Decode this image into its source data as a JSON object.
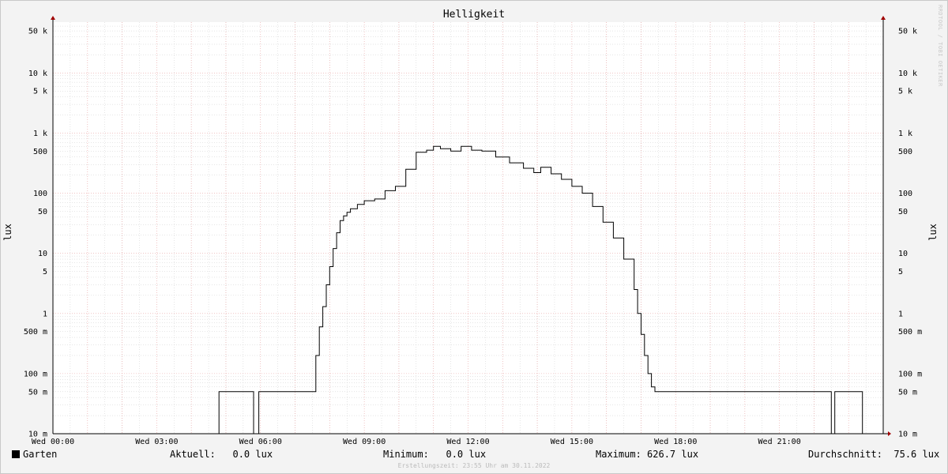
{
  "chart_data": {
    "type": "line",
    "title": "Helligkeit",
    "ylabel": "lux",
    "yscale": "log",
    "ylim": [
      0.01,
      70000
    ],
    "xlim": [
      0,
      24
    ],
    "y_ticks": [
      {
        "value": 50000,
        "label": "50 k"
      },
      {
        "value": 10000,
        "label": "10 k"
      },
      {
        "value": 5000,
        "label": "5 k"
      },
      {
        "value": 1000,
        "label": "1 k"
      },
      {
        "value": 500,
        "label": "500"
      },
      {
        "value": 100,
        "label": "100"
      },
      {
        "value": 50,
        "label": "50"
      },
      {
        "value": 10,
        "label": "10"
      },
      {
        "value": 5,
        "label": "5"
      },
      {
        "value": 1,
        "label": "1"
      },
      {
        "value": 0.5,
        "label": "500 m"
      },
      {
        "value": 0.1,
        "label": "100 m"
      },
      {
        "value": 0.05,
        "label": "50 m"
      },
      {
        "value": 0.01,
        "label": "10 m"
      }
    ],
    "x_ticks": [
      {
        "value": 0,
        "label": "Wed 00:00"
      },
      {
        "value": 3,
        "label": "Wed 03:00"
      },
      {
        "value": 6,
        "label": "Wed 06:00"
      },
      {
        "value": 9,
        "label": "Wed 09:00"
      },
      {
        "value": 12,
        "label": "Wed 12:00"
      },
      {
        "value": 15,
        "label": "Wed 15:00"
      },
      {
        "value": 18,
        "label": "Wed 18:00"
      },
      {
        "value": 21,
        "label": "Wed 21:00"
      }
    ],
    "grid": true,
    "colors": {
      "line": "#000000",
      "major_grid": "#e8a0a0",
      "minor_grid": "#cccccc",
      "axis": "#000000",
      "arrow": "#a00000"
    },
    "series": [
      {
        "name": "Garten",
        "x": [
          0,
          4.8,
          4.8,
          5.8,
          5.8,
          5.95,
          5.95,
          7.5,
          7.6,
          7.7,
          7.8,
          7.9,
          8.0,
          8.1,
          8.2,
          8.3,
          8.4,
          8.5,
          8.6,
          8.8,
          9.0,
          9.3,
          9.6,
          9.9,
          10.2,
          10.5,
          10.8,
          11.0,
          11.2,
          11.5,
          11.8,
          12.1,
          12.4,
          12.8,
          13.2,
          13.6,
          13.9,
          14.1,
          14.4,
          14.7,
          15.0,
          15.3,
          15.6,
          15.9,
          16.2,
          16.5,
          16.8,
          16.9,
          17.0,
          17.1,
          17.2,
          17.3,
          17.4,
          17.5,
          17.6,
          17.7,
          17.7,
          22.5,
          22.5,
          22.6,
          22.6,
          23.4,
          23.4,
          24
        ],
        "values": [
          0.01,
          0.01,
          0.05,
          0.05,
          0.01,
          0.01,
          0.05,
          0.05,
          0.2,
          0.6,
          1.3,
          3,
          6,
          12,
          22,
          35,
          42,
          48,
          55,
          65,
          75,
          80,
          110,
          130,
          250,
          480,
          520,
          600,
          550,
          500,
          600,
          520,
          500,
          400,
          320,
          260,
          220,
          270,
          210,
          170,
          130,
          100,
          60,
          33,
          18,
          8,
          2.5,
          1.0,
          0.45,
          0.2,
          0.1,
          0.06,
          0.05,
          0.05,
          0.05,
          0.05,
          0.05,
          0.05,
          0.01,
          0.01,
          0.05,
          0.05,
          0.01,
          0.01
        ]
      }
    ]
  },
  "legend": {
    "series_name": "Garten",
    "current_label": "Aktuell:",
    "current_value": "0.0 lux",
    "min_label": "Minimum:",
    "min_value": "0.0 lux",
    "max_label": "Maximum:",
    "max_value": "626.7 lux",
    "avg_label": "Durchschnitt:",
    "avg_value": "75.6 lux"
  },
  "footer": "Erstellungszeit: 23:55 Uhr am 30.11.2022",
  "watermark": "RRDTOOL / TOBI OETIKER"
}
